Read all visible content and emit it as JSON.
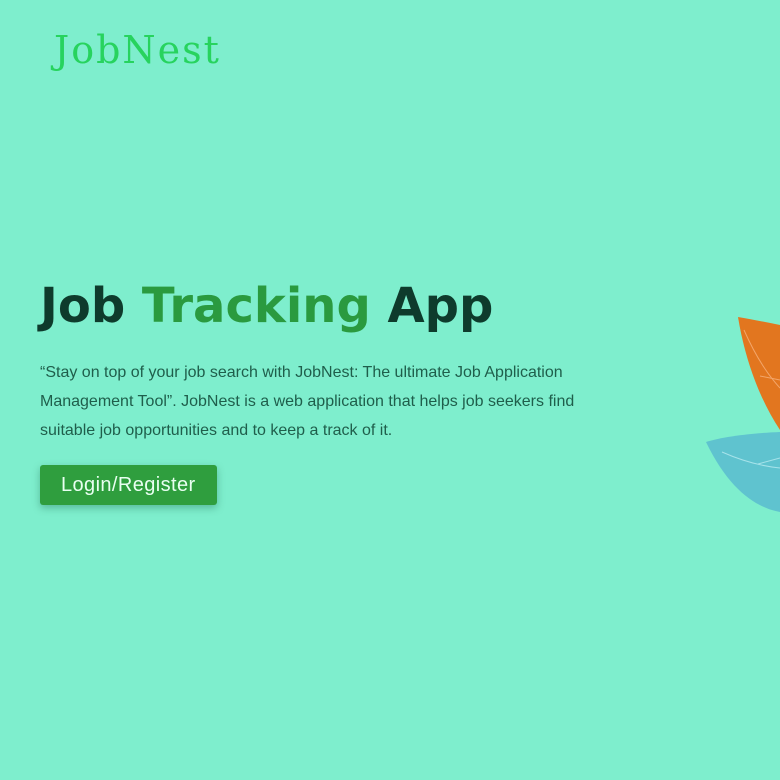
{
  "brand": {
    "logo_text": "JobNest"
  },
  "hero": {
    "title_part1": "Job ",
    "title_accent": "Tracking",
    "title_part2": " App",
    "description": "“Stay on top of your job search with JobNest: The ultimate Job Application Management Tool”. JobNest is a web application that helps job seekers find suitable job opportunities and to keep a track of it.",
    "cta_label": "Login/Register"
  },
  "colors": {
    "background": "#7eeecd",
    "logo": "#27d35e",
    "title_dark": "#0e3b2c",
    "title_accent": "#2a9a3f",
    "button": "#2f9e3e",
    "leaf_orange": "#e2761f",
    "leaf_blue": "#5fc3cf"
  },
  "decoration": {
    "icon": "leaves-illustration"
  }
}
